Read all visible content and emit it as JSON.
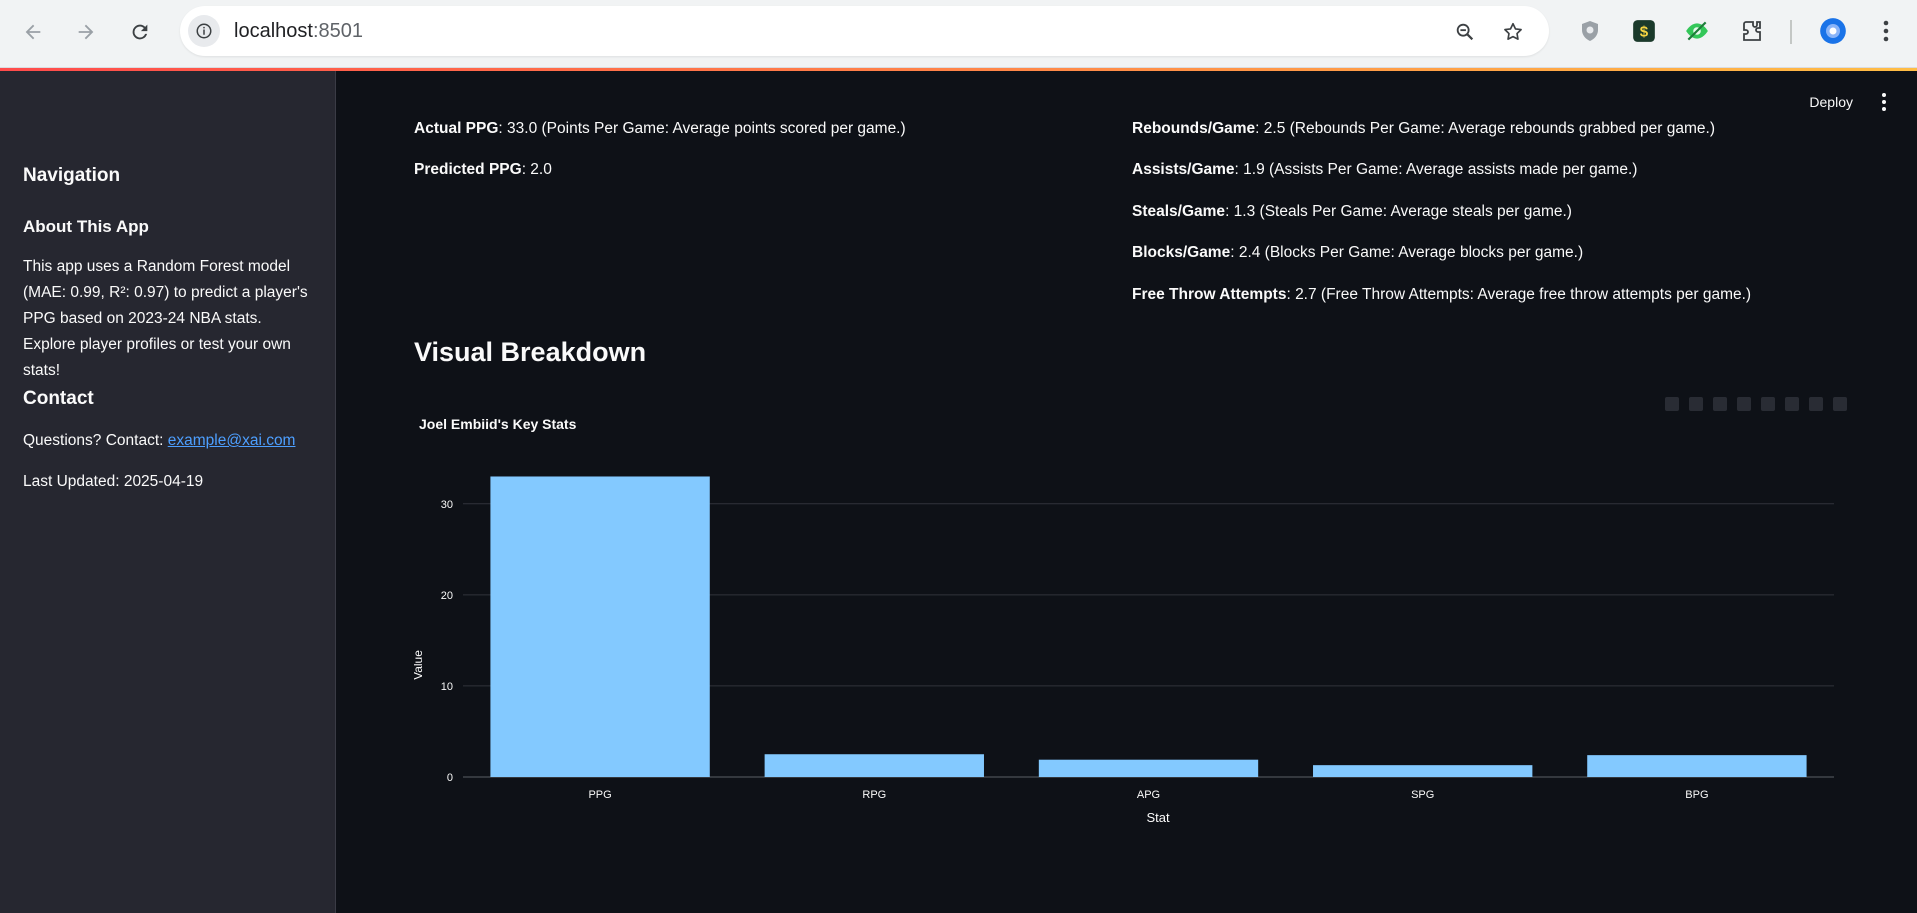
{
  "browser": {
    "url_host": "localhost",
    "url_port": ":8501",
    "back_icon": "back-arrow-icon",
    "forward_icon": "forward-arrow-icon",
    "reload_icon": "reload-icon"
  },
  "sidebar": {
    "nav_heading": "Navigation",
    "about_heading": "About This App",
    "about_text": "This app uses a Random Forest model (MAE: 0.99, R²: 0.97) to predict a player's PPG based on 2023-24 NBA stats. Explore player profiles or test your own stats!",
    "contact_heading": "Contact",
    "contact_prefix": "Questions? Contact: ",
    "contact_email": "example@xai.com",
    "last_updated": "Last Updated: 2025-04-19"
  },
  "header": {
    "deploy_label": "Deploy"
  },
  "stats_left": [
    {
      "label": "Actual PPG",
      "text": ": 33.0 (Points Per Game: Average points scored per game.)"
    },
    {
      "label": "Predicted PPG",
      "text": ": 2.0"
    }
  ],
  "stats_right": [
    {
      "label": "Rebounds/Game",
      "text": ": 2.5 (Rebounds Per Game: Average rebounds grabbed per game.)"
    },
    {
      "label": "Assists/Game",
      "text": ": 1.9 (Assists Per Game: Average assists made per game.)"
    },
    {
      "label": "Steals/Game",
      "text": ": 1.3 (Steals Per Game: Average steals per game.)"
    },
    {
      "label": "Blocks/Game",
      "text": ": 2.4 (Blocks Per Game: Average blocks per game.)"
    },
    {
      "label": "Free Throw Attempts",
      "text": ": 2.7 (Free Throw Attempts: Average free throw attempts per game.)"
    }
  ],
  "section_title": "Visual Breakdown",
  "chart_data": {
    "type": "bar",
    "title": "Joel Embiid's Key Stats",
    "xlabel": "Stat",
    "ylabel": "Value",
    "categories": [
      "PPG",
      "RPG",
      "APG",
      "SPG",
      "BPG"
    ],
    "values": [
      33.0,
      2.5,
      1.9,
      1.3,
      2.4
    ],
    "yticks": [
      "0",
      "10",
      "20",
      "30"
    ],
    "ylim": [
      0,
      34.7
    ],
    "grid": true,
    "bar_color": "#83c9ff"
  }
}
